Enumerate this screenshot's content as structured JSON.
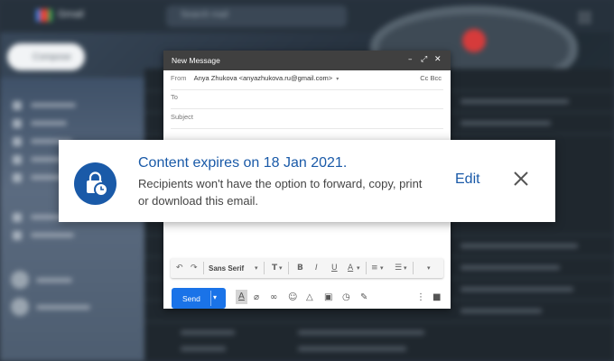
{
  "background": {
    "app_name": "Gmail",
    "search_placeholder": "Search mail",
    "compose_label": "Compose"
  },
  "compose": {
    "title": "New Message",
    "from_label": "From",
    "from_value": "Anya Zhukova <anyazhukova.ru@gmail.com>",
    "cc_bcc": "Cc Bcc",
    "to_label": "To",
    "subject_placeholder": "Subject",
    "font_name": "Sans Serif",
    "send_label": "Send"
  },
  "notice": {
    "title": "Content expires on 18 Jan 2021.",
    "description": "Recipients won't have the option to forward, copy, print or download this email.",
    "edit_label": "Edit",
    "icon": "confidential-mode-lock-clock-icon"
  },
  "colors": {
    "accent": "#1a5aa8",
    "send_button": "#1a73e8",
    "compose_titlebar": "#404040"
  }
}
